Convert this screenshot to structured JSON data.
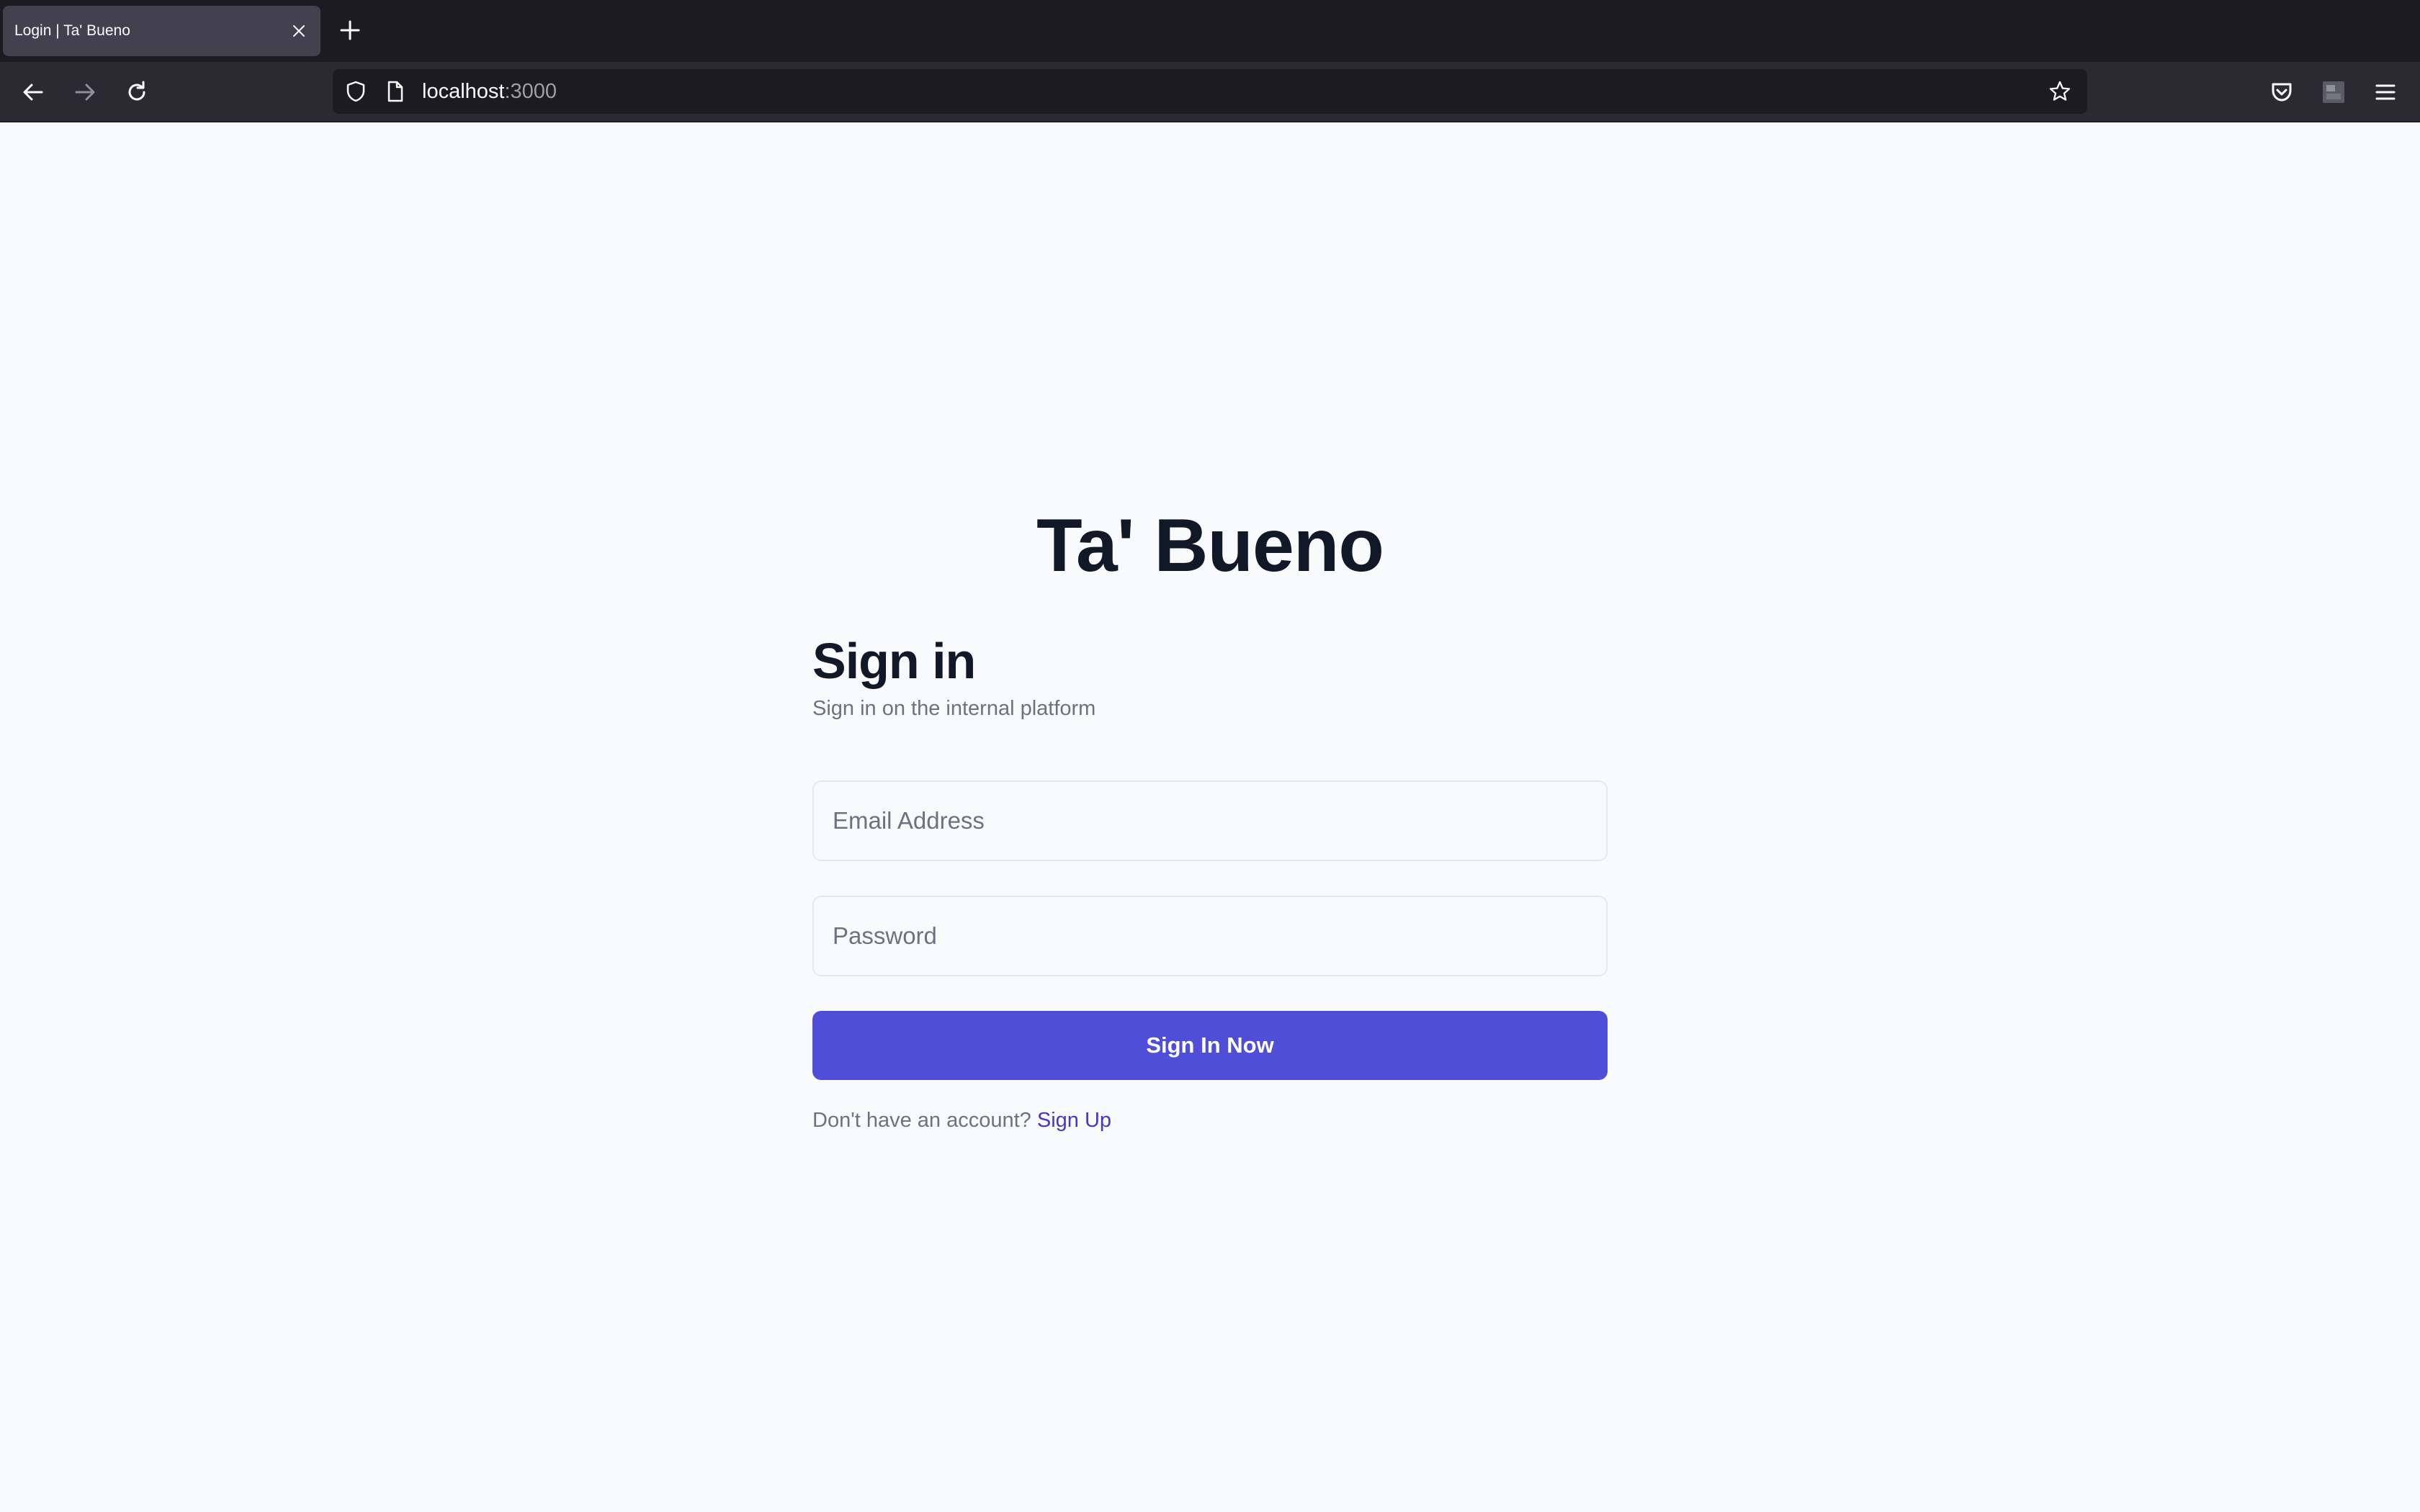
{
  "browser": {
    "tab": {
      "title": "Login | Ta' Bueno",
      "close_icon": "close-icon"
    },
    "new_tab_icon": "plus-icon",
    "nav": {
      "back_icon": "arrow-left-icon",
      "forward_icon": "arrow-right-icon",
      "reload_icon": "reload-icon"
    },
    "url": {
      "host": "localhost",
      "port": ":3000",
      "shield_icon": "shield-icon",
      "page_icon": "page-icon",
      "bookmark_icon": "star-icon"
    },
    "toolbar_icons": [
      "pocket-icon",
      "extension-icon",
      "menu-icon"
    ],
    "colors": {
      "tabbar": "#1c1b22",
      "navbar": "#2b2a33",
      "active_tab": "#42414d"
    }
  },
  "page": {
    "brand": "Ta' Bueno",
    "heading": "Sign in",
    "subtitle": "Sign in on the internal platform",
    "email": {
      "placeholder": "Email Address",
      "value": ""
    },
    "password": {
      "placeholder": "Password",
      "value": ""
    },
    "submit_label": "Sign In Now",
    "signup_prompt": "Don't have an account?",
    "signup_link": "Sign Up",
    "colors": {
      "background": "#f9fafb",
      "accent": "#4f4ed8",
      "link": "#4338ca",
      "text": "#111827",
      "muted": "#6b7280"
    }
  }
}
